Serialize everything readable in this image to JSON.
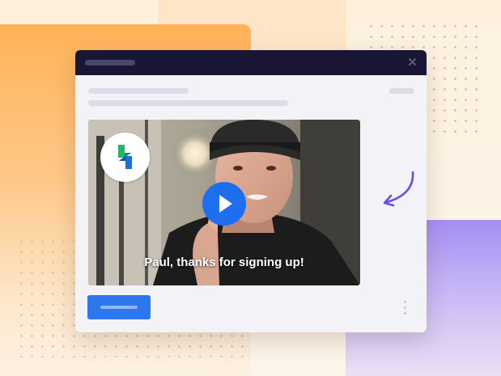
{
  "video": {
    "caption": "Paul, thanks for signing up!",
    "logo_icon": "brand-logo-icon",
    "play_icon": "play-icon"
  },
  "window": {
    "close_icon": "close-icon"
  },
  "colors": {
    "accent": "#1e6ef0",
    "titlebar": "#191635",
    "arrow": "#6b4ce6"
  }
}
